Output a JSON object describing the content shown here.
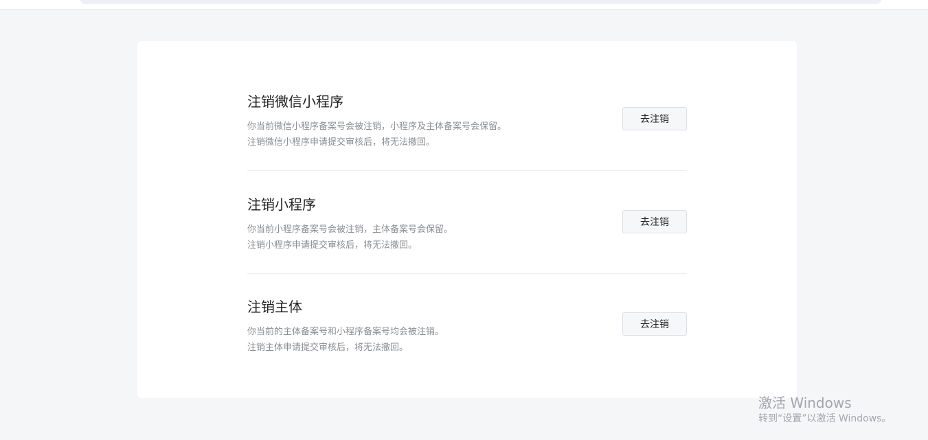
{
  "sections": [
    {
      "title": "注销微信小程序",
      "desc": [
        "你当前微信小程序备案号会被注销，小程序及主体备案号会保留。",
        "注销微信小程序申请提交审核后，将无法撤回。"
      ],
      "button": "去注销"
    },
    {
      "title": "注销小程序",
      "desc": [
        "你当前小程序备案号会被注销，主体备案号会保留。",
        "注销小程序申请提交审核后，将无法撤回。"
      ],
      "button": "去注销"
    },
    {
      "title": "注销主体",
      "desc": [
        "你当前的主体备案号和小程序备案号均会被注销。",
        "注销主体申请提交审核后，将无法撤回。"
      ],
      "button": "去注销"
    }
  ],
  "watermark": {
    "line1": "激活 Windows",
    "line2": "转到“设置”以激活 Windows。"
  }
}
